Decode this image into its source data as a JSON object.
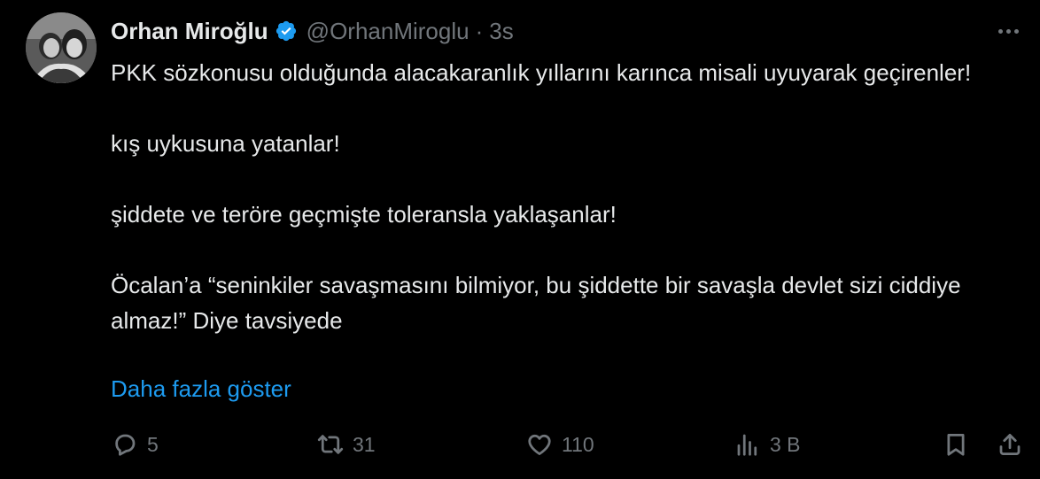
{
  "tweet": {
    "author_name": "Orhan Miroğlu",
    "handle": "@OrhanMiroglu",
    "separator": "·",
    "time": "3s",
    "lines": [
      "PKK sözkonusu olduğunda alacakaranlık yıllarını karınca misali uyuyarak geçirenler!",
      "kış uykusuna yatanlar!",
      "şiddete ve teröre geçmişte toleransla yaklaşanlar!",
      "Öcalan’a “seninkiler savaşmasını bilmiyor, bu şiddette bir savaşla devlet sizi ciddiye almaz!” Diye tavsiyede"
    ],
    "show_more": "Daha fazla göster"
  },
  "actions": {
    "replies": "5",
    "retweets": "31",
    "likes": "110",
    "views": "3 B"
  },
  "icons": {
    "verified": "verified-badge-icon",
    "more": "more-dots-icon",
    "reply": "reply-icon",
    "retweet": "retweet-icon",
    "like": "heart-icon",
    "views": "views-chart-icon",
    "bookmark": "bookmark-icon",
    "share": "share-icon"
  },
  "colors": {
    "background": "#000000",
    "text": "#e7e9ea",
    "muted": "#71767b",
    "link": "#1d9bf0",
    "verified": "#1d9bf0"
  }
}
